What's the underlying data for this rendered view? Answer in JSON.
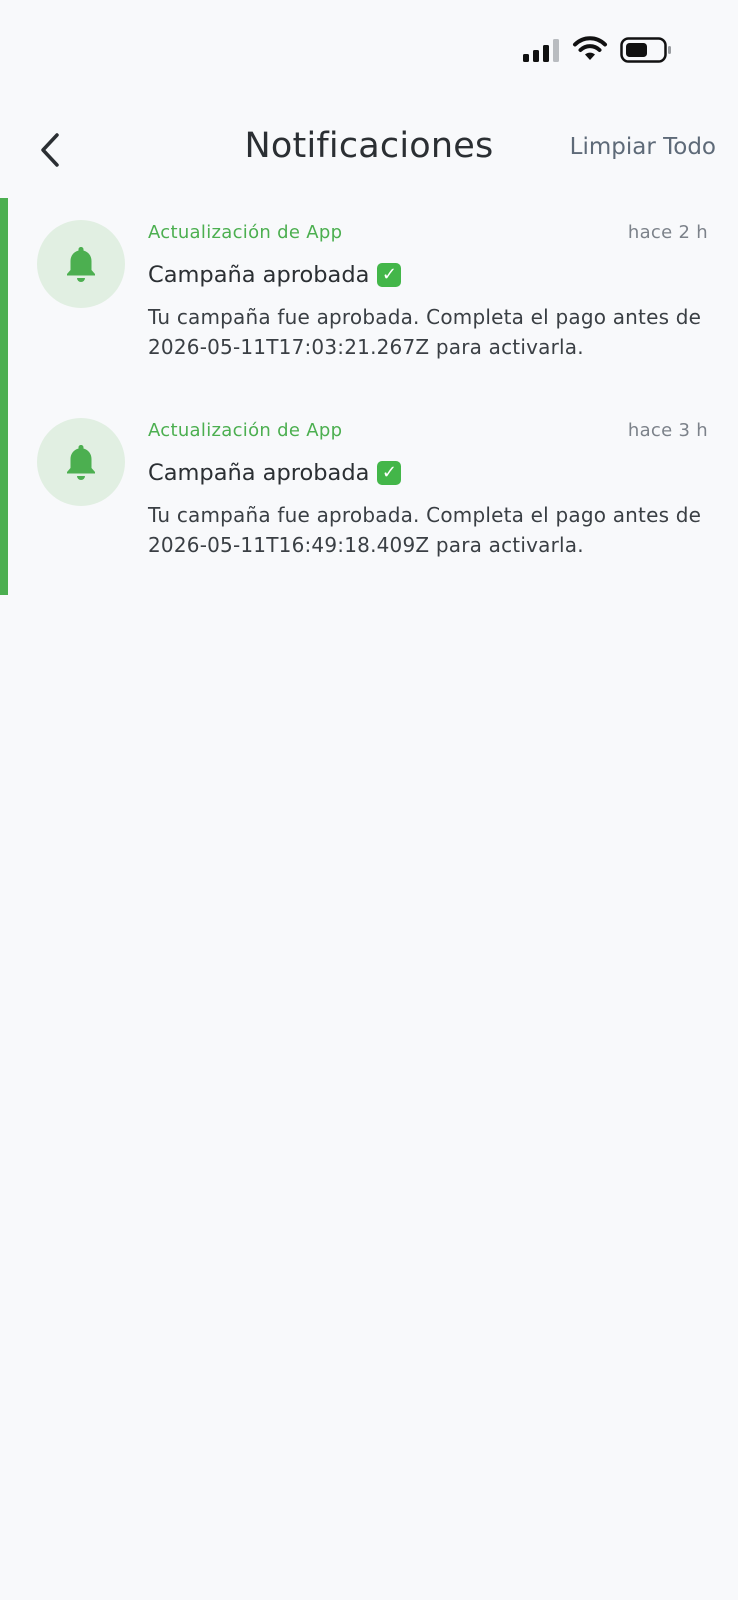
{
  "status_bar": {
    "signal_icon": "cellular-signal-icon",
    "wifi_icon": "wifi-icon",
    "battery_icon": "battery-icon"
  },
  "header": {
    "back_icon": "chevron-left-icon",
    "title": "Notificaciones",
    "clear_all_label": "Limpiar Todo"
  },
  "colors": {
    "accent": "#4caf50",
    "icon_bg": "#e1efe2",
    "background": "#f8f9fb"
  },
  "notifications": [
    {
      "icon": "bell-icon",
      "category": "Actualización de App",
      "time": "hace 2 h",
      "title": "Campaña aprobada",
      "emoji": "✓",
      "body": "Tu campaña fue aprobada. Completa el pago antes de 2026-05-11T17:03:21.267Z para activarla."
    },
    {
      "icon": "bell-icon",
      "category": "Actualización de App",
      "time": "hace 3 h",
      "title": "Campaña aprobada",
      "emoji": "✓",
      "body": "Tu campaña fue aprobada. Completa el pago antes de 2026-05-11T16:49:18.409Z para activarla."
    }
  ]
}
